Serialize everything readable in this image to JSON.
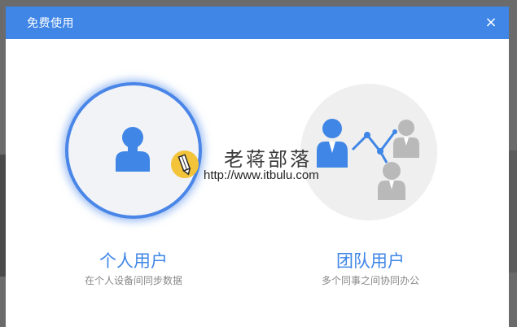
{
  "dialog": {
    "title": "免费使用",
    "close_label": "×"
  },
  "options": {
    "personal": {
      "title": "个人用户",
      "description": "在个人设备间同步数据"
    },
    "team": {
      "title": "团队用户",
      "description": "多个同事之间协同办公"
    }
  },
  "watermark": {
    "name": "老蒋部落",
    "url": "http://www.itbulu.com"
  },
  "colors": {
    "accent": "#3f86e6",
    "icon_gray": "#b9b9b9",
    "badge": "#f3c43a"
  },
  "icons": {
    "personal": "person-icon",
    "team": "team-network-icon",
    "edit": "pencil-icon"
  }
}
